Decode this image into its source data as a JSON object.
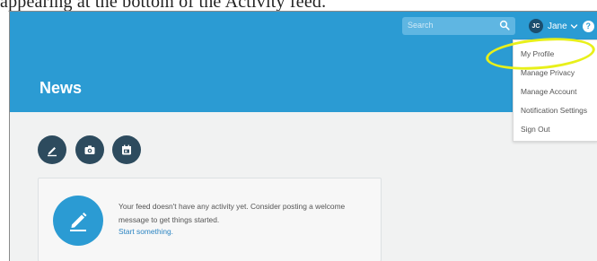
{
  "caption_strip": {
    "text": "appearing at the bottom of the Activity feed."
  },
  "header": {
    "search": {
      "placeholder": "Search",
      "icon": "search-icon"
    },
    "user": {
      "avatar_initials": "JC",
      "name": "Jane",
      "icon": "chevron-down-icon"
    },
    "help_label": "?",
    "title": "News",
    "colors": {
      "header_bg": "#2b9bd3",
      "content_bg": "#f1f2f2",
      "action_btn_bg": "#2d4b5e",
      "highlight": "#e8f01a"
    }
  },
  "actions": [
    {
      "name": "pencil-icon",
      "label": "Write post"
    },
    {
      "name": "camera-icon",
      "label": "Add photo"
    },
    {
      "name": "calendar-icon",
      "label": "Add event"
    }
  ],
  "feed_empty": {
    "message": "Your feed doesn't have any activity yet. Consider posting a welcome message to get things started.",
    "link": "Start something."
  },
  "user_menu": {
    "items": [
      "My Profile",
      "Manage Privacy",
      "Manage Account",
      "Notification Settings",
      "Sign Out"
    ],
    "highlighted_item": "My Profile"
  }
}
